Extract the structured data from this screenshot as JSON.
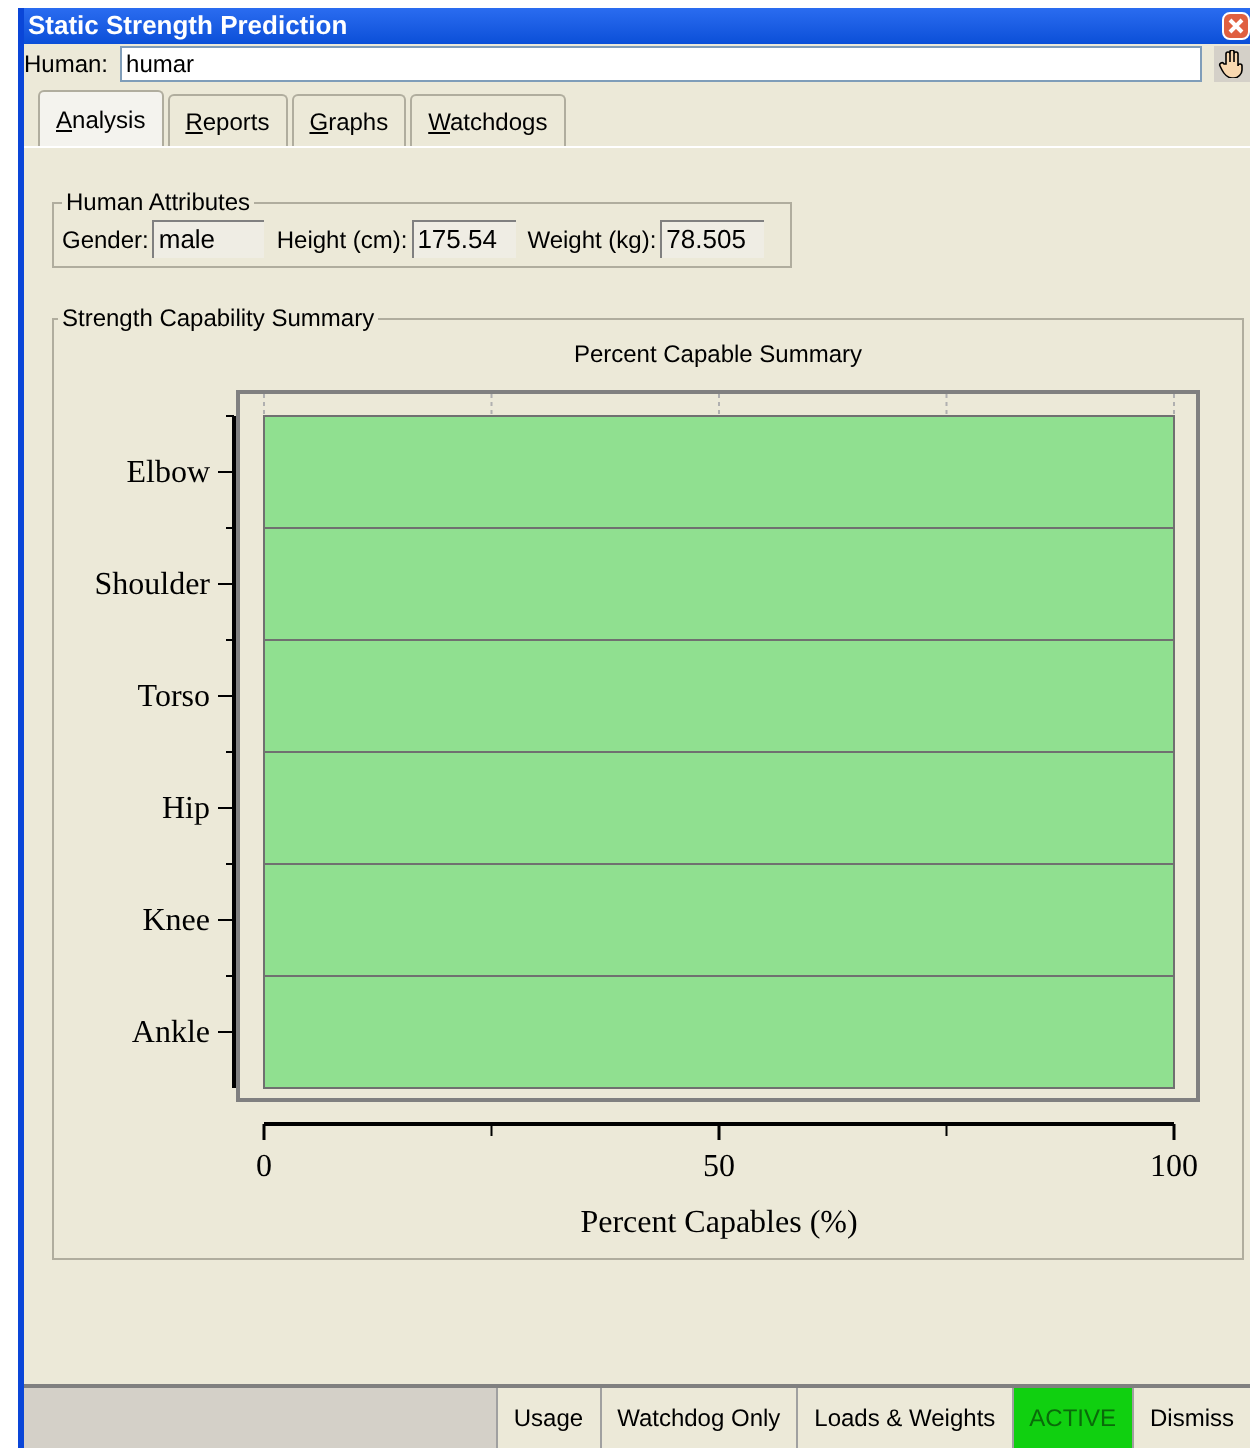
{
  "window": {
    "title": "Static Strength Prediction"
  },
  "human": {
    "label": "Human:",
    "value": "humar"
  },
  "tabs": [
    {
      "label": "Analysis",
      "selected": true
    },
    {
      "label": "Reports",
      "selected": false
    },
    {
      "label": "Graphs",
      "selected": false
    },
    {
      "label": "Watchdogs",
      "selected": false
    }
  ],
  "human_attributes": {
    "title": "Human Attributes",
    "fields": [
      {
        "label": "Gender:",
        "value": "male"
      },
      {
        "label": "Height (cm):",
        "value": "175.54"
      },
      {
        "label": "Weight (kg):",
        "value": "78.505"
      }
    ]
  },
  "strength_summary": {
    "title": "Strength Capability Summary",
    "chart_data": {
      "type": "bar",
      "orientation": "horizontal",
      "title": "Percent Capable Summary",
      "xlabel": "Percent Capables (%)",
      "categories": [
        "Elbow",
        "Shoulder",
        "Torso",
        "Hip",
        "Knee",
        "Ankle"
      ],
      "series": [
        {
          "color": "#90e090",
          "values": [
            100,
            100,
            100,
            100,
            100,
            100
          ]
        }
      ],
      "xlim": [
        0,
        100
      ],
      "xticks": [
        0,
        50,
        100
      ]
    }
  },
  "status_bar": [
    {
      "label": "Usage",
      "active": false
    },
    {
      "label": "Watchdog Only",
      "active": false
    },
    {
      "label": "Loads & Weights",
      "active": false
    },
    {
      "label": "ACTIVE",
      "active": true
    },
    {
      "label": "Dismiss",
      "active": false
    }
  ]
}
